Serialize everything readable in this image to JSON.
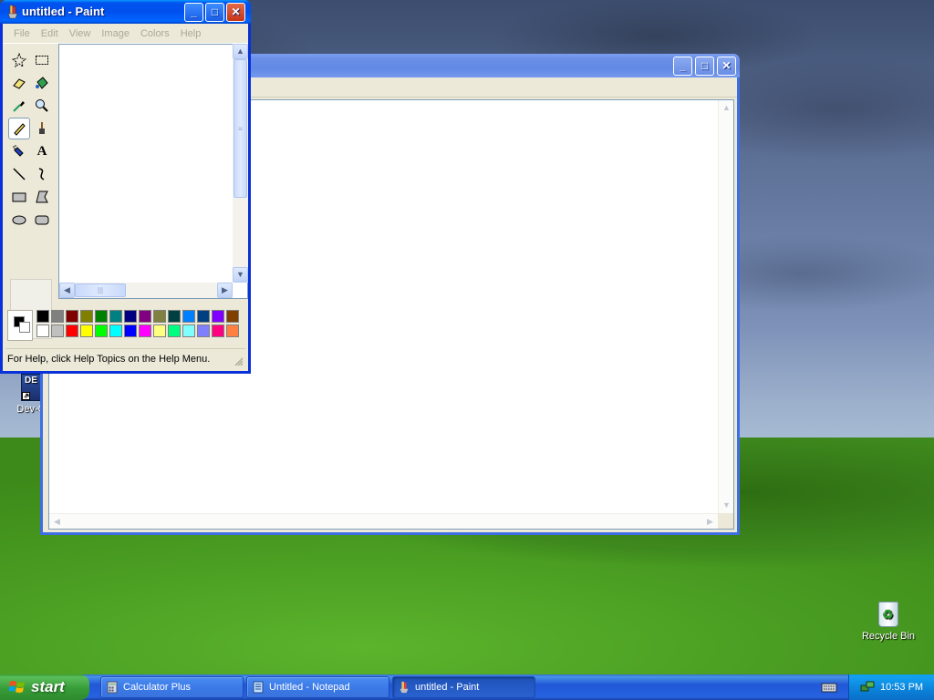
{
  "desktop": {
    "icons": [
      {
        "label": "Dev-C"
      },
      {
        "label": "Recycle Bin"
      }
    ],
    "devcpp_glyph": "DE"
  },
  "paint": {
    "title": "untitled - Paint",
    "menu": [
      "File",
      "Edit",
      "View",
      "Image",
      "Colors",
      "Help"
    ],
    "status": "For Help, click Help Topics on the Help Menu.",
    "palette_top": [
      "#000000",
      "#808080",
      "#800000",
      "#808000",
      "#008000",
      "#008080",
      "#000080",
      "#800080",
      "#808040",
      "#004040",
      "#0080ff",
      "#004080",
      "#8000ff",
      "#804000"
    ],
    "palette_bottom": [
      "#ffffff",
      "#c0c0c0",
      "#ff0000",
      "#ffff00",
      "#00ff00",
      "#00ffff",
      "#0000ff",
      "#ff00ff",
      "#ffff80",
      "#00ff80",
      "#80ffff",
      "#8080ff",
      "#ff0080",
      "#ff8040"
    ],
    "tools": [
      "free-select-icon",
      "rect-select-icon",
      "eraser-icon",
      "fill-bucket-icon",
      "color-picker-icon",
      "magnifier-icon",
      "pencil-icon",
      "brush-icon",
      "airbrush-icon",
      "text-icon",
      "line-icon",
      "curve-icon",
      "rectangle-icon",
      "polygon-icon",
      "ellipse-icon",
      "rounded-rect-icon"
    ],
    "text_tool_glyph": "A"
  },
  "notepad": {
    "title": "Untitled - Notepad"
  },
  "taskbar": {
    "start_label": "start",
    "buttons": [
      {
        "label": "Calculator Plus"
      },
      {
        "label": "Untitled - Notepad"
      },
      {
        "label": "untitled - Paint"
      }
    ],
    "clock": "10:53 PM"
  },
  "colors": {
    "title_active": "#0054e3",
    "title_inactive": "#6b8fe8",
    "start_green": "#379c37",
    "taskbar_blue": "#2157d7"
  }
}
